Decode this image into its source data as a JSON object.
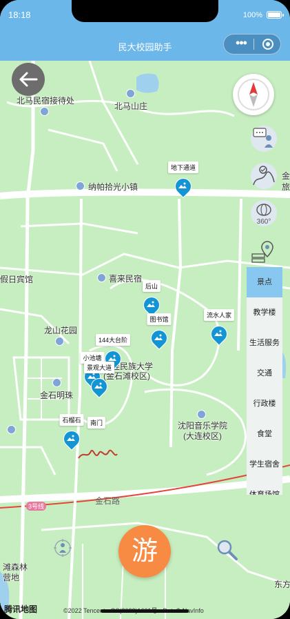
{
  "statusbar": {
    "time": "18:18",
    "battery": "100%"
  },
  "navbar": {
    "title": "民大校园助手"
  },
  "map": {
    "labels": {
      "beima_reception": "北马民宿接待处",
      "beima_villa": "北马山庄",
      "napa_town": "纳帕拾光小镇",
      "holiday_hotel": "假日宾馆",
      "xilai_homestay": "喜来民宿",
      "longshan_garden": "龙山花园",
      "minzu_univ": "大连民族大学",
      "minzu_campus": "(金石滩校区)",
      "jinshi_pearl": "金石明珠",
      "conservatory": "沈阳音乐学院",
      "conservatory_campus": "(大连校区)",
      "jinshi_road": "金石路",
      "line3": "3号线",
      "forest_left1": "滩森林",
      "forest_left2": "营地",
      "east": "东方",
      "side_partial1": "金",
      "side_partial2": "旅"
    },
    "markers": {
      "underground_parking": "地下通道",
      "houshan": "后山",
      "library": "图书馆",
      "river_home": "流水人家",
      "pavilion144": "144大台阶",
      "small_pond": "小池塘",
      "viewing_platform": "景观大道",
      "shimingshi": "石榴石",
      "south_gate": "南门"
    }
  },
  "tabs": [
    {
      "label": "景点"
    },
    {
      "label": "教学楼"
    },
    {
      "label": "生活服务"
    },
    {
      "label": "交通"
    },
    {
      "label": "行政楼"
    },
    {
      "label": "食堂"
    },
    {
      "label": "学生宿舍"
    },
    {
      "label": "体育场馆"
    }
  ],
  "tab_active_index": 0,
  "fab": {
    "tour_label": "游"
  },
  "footer": {
    "logo": "腾讯地图",
    "copyright": "©2022 Tencent · GS(2022)1601号 · Data© NavInfo"
  },
  "icons": {
    "back": "arrow-left-icon",
    "compass": "compass-icon",
    "chat": "chat-icon",
    "route": "route-icon",
    "view360": "view-360-icon",
    "locate": "pin-stack-icon",
    "search": "search-icon",
    "locator": "person-locate-icon"
  },
  "colors": {
    "navbar": "#6cb7ea",
    "map_bg": "#c7eec0",
    "marker": "#1395d5",
    "tab_active": "#88c8f0",
    "fab": "#f78b43"
  }
}
